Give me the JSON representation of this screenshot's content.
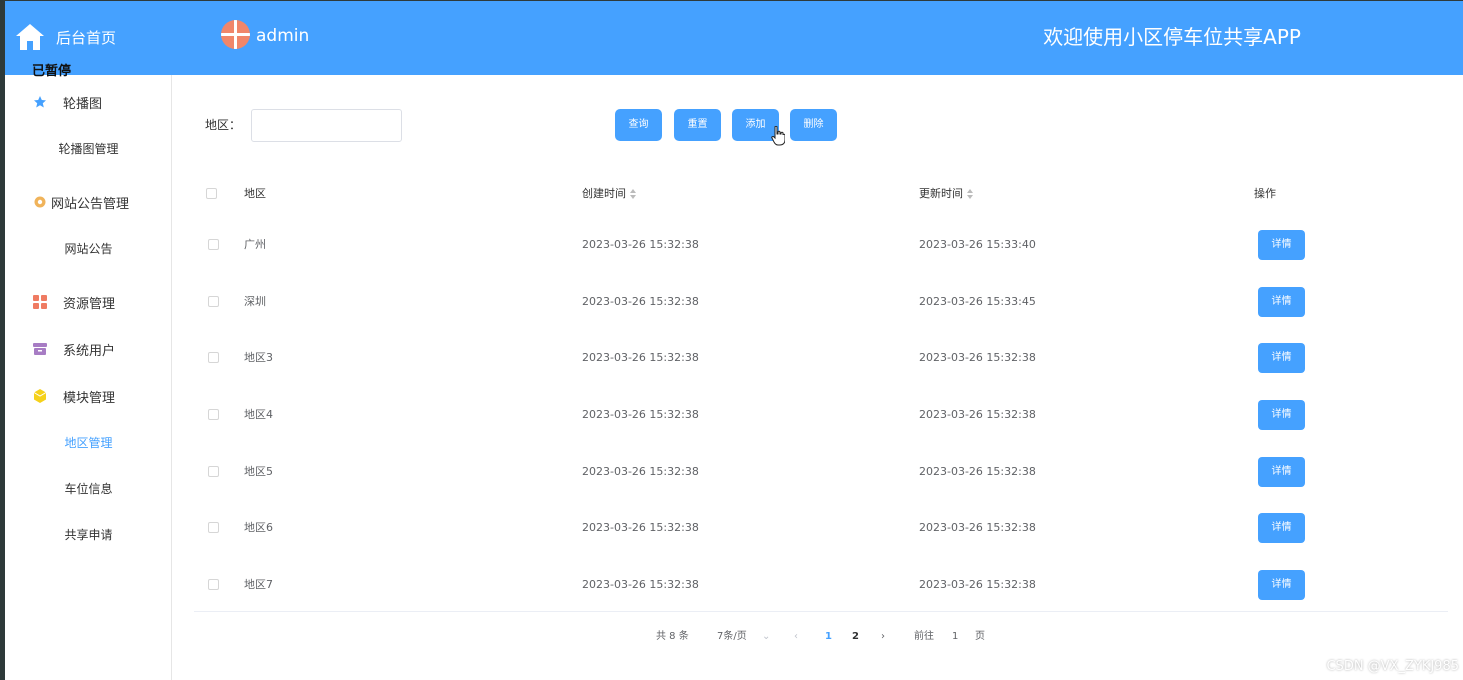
{
  "sidebar": {
    "home_label": "后台首页",
    "overlay_text": "已暂停",
    "menu": [
      {
        "label": "轮播图",
        "icon": "star-icon"
      },
      {
        "label": "网站公告管理",
        "icon": "gear-icon"
      },
      {
        "label": "资源管理",
        "icon": "grid-icon"
      },
      {
        "label": "系统用户",
        "icon": "box-icon"
      },
      {
        "label": "模块管理",
        "icon": "cube-icon"
      }
    ],
    "sub": {
      "carousel_manage": "轮播图管理",
      "site_notice": "网站公告",
      "region_manage": "地区管理",
      "parking_info": "车位信息",
      "share_apply": "共享申请"
    }
  },
  "header": {
    "username": "admin",
    "welcome": "欢迎使用小区停车位共享APP"
  },
  "colors": {
    "primary": "#45a1ff",
    "text": "#606266",
    "avatar": "#f0866a"
  },
  "search": {
    "label": "地区：",
    "value": "",
    "buttons": {
      "query": "查询",
      "reset": "重置",
      "add": "添加",
      "delete": "删除"
    }
  },
  "table": {
    "headers": {
      "region": "地区",
      "created": "创建时间",
      "updated": "更新时间",
      "action": "操作"
    },
    "detail_label": "详情",
    "rows": [
      {
        "region": "广州",
        "created": "2023-03-26 15:32:38",
        "updated": "2023-03-26 15:33:40"
      },
      {
        "region": "深圳",
        "created": "2023-03-26 15:32:38",
        "updated": "2023-03-26 15:33:45"
      },
      {
        "region": "地区3",
        "created": "2023-03-26 15:32:38",
        "updated": "2023-03-26 15:32:38"
      },
      {
        "region": "地区4",
        "created": "2023-03-26 15:32:38",
        "updated": "2023-03-26 15:32:38"
      },
      {
        "region": "地区5",
        "created": "2023-03-26 15:32:38",
        "updated": "2023-03-26 15:32:38"
      },
      {
        "region": "地区6",
        "created": "2023-03-26 15:32:38",
        "updated": "2023-03-26 15:32:38"
      },
      {
        "region": "地区7",
        "created": "2023-03-26 15:32:38",
        "updated": "2023-03-26 15:32:38"
      }
    ]
  },
  "pagination": {
    "total": "共 8 条",
    "page_size": "7条/页",
    "pages": [
      "1",
      "2"
    ],
    "current": "1",
    "goto_prefix": "前往",
    "goto_value": "1",
    "goto_suffix": "页"
  },
  "watermark": "CSDN @VX_ZYKJ985"
}
